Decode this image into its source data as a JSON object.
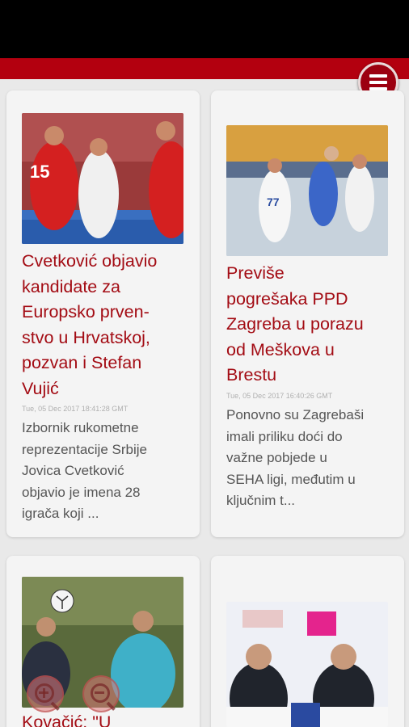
{
  "articles": [
    {
      "title": "Cvetković objavio kandidate za Europsko prven-stvo u Hrvatskoj, pozvan i Stefan Vujić",
      "title_lines": [
        "Cvetković objavio",
        "kandidate za",
        "Europsko prven-",
        "stvo u Hrvatskoj,",
        "pozvan i Stefan",
        "Vujić"
      ],
      "date": "Tue, 05 Dec 2017 18:41:28 GMT",
      "excerpt_lines": [
        "Izbornik rukometne",
        "reprezentacije Srbije",
        "Jovica Cvetković",
        "objavio je imena 28",
        "igrača koji ..."
      ],
      "image_icon": "handball-players-photo"
    },
    {
      "title_lines": [
        "Previše",
        "pogrešaka PPD",
        "Zagreba u porazu",
        "od Meškova u",
        "Brestu"
      ],
      "date": "Tue, 05 Dec 2017 16:40:26 GMT",
      "excerpt_lines": [
        "Ponovno su Zagrebaši",
        "imali priliku doći do",
        "važne pobjede u",
        "SEHA ligi, međutim u",
        "ključnim t..."
      ],
      "image_icon": "handball-match-photo"
    },
    {
      "title_lines": [
        "Kovačić: \"U"
      ],
      "image_icon": "football-training-photo"
    },
    {
      "image_icon": "press-conference-photo"
    }
  ],
  "menu": {
    "icon": "hamburger-menu-icon"
  },
  "zoom": {
    "zoom_in_icon": "zoom-in-icon",
    "zoom_out_icon": "zoom-out-icon"
  },
  "colors": {
    "brand_red": "#b3000f",
    "title_red": "#a30c14"
  }
}
